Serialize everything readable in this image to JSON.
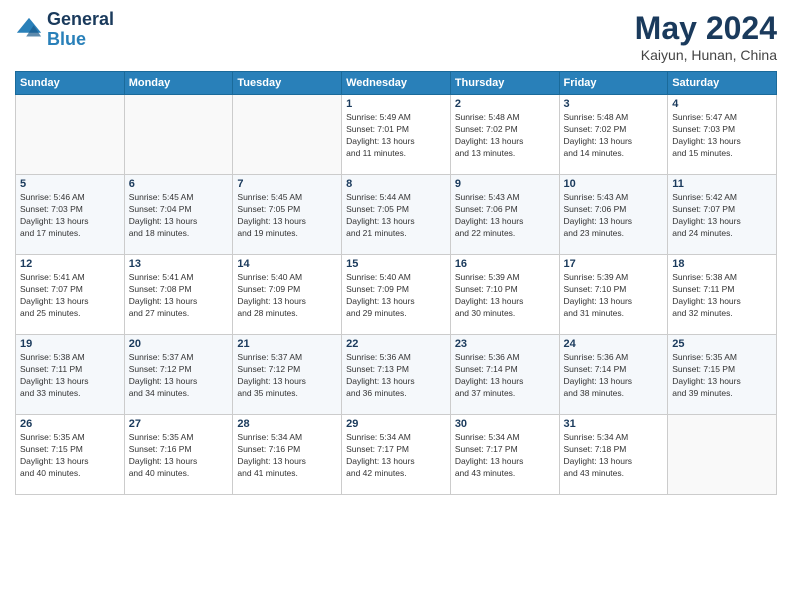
{
  "header": {
    "logo_line1": "General",
    "logo_line2": "Blue",
    "month": "May 2024",
    "location": "Kaiyun, Hunan, China"
  },
  "weekdays": [
    "Sunday",
    "Monday",
    "Tuesday",
    "Wednesday",
    "Thursday",
    "Friday",
    "Saturday"
  ],
  "weeks": [
    [
      {
        "day": "",
        "info": ""
      },
      {
        "day": "",
        "info": ""
      },
      {
        "day": "",
        "info": ""
      },
      {
        "day": "1",
        "info": "Sunrise: 5:49 AM\nSunset: 7:01 PM\nDaylight: 13 hours\nand 11 minutes."
      },
      {
        "day": "2",
        "info": "Sunrise: 5:48 AM\nSunset: 7:02 PM\nDaylight: 13 hours\nand 13 minutes."
      },
      {
        "day": "3",
        "info": "Sunrise: 5:48 AM\nSunset: 7:02 PM\nDaylight: 13 hours\nand 14 minutes."
      },
      {
        "day": "4",
        "info": "Sunrise: 5:47 AM\nSunset: 7:03 PM\nDaylight: 13 hours\nand 15 minutes."
      }
    ],
    [
      {
        "day": "5",
        "info": "Sunrise: 5:46 AM\nSunset: 7:03 PM\nDaylight: 13 hours\nand 17 minutes."
      },
      {
        "day": "6",
        "info": "Sunrise: 5:45 AM\nSunset: 7:04 PM\nDaylight: 13 hours\nand 18 minutes."
      },
      {
        "day": "7",
        "info": "Sunrise: 5:45 AM\nSunset: 7:05 PM\nDaylight: 13 hours\nand 19 minutes."
      },
      {
        "day": "8",
        "info": "Sunrise: 5:44 AM\nSunset: 7:05 PM\nDaylight: 13 hours\nand 21 minutes."
      },
      {
        "day": "9",
        "info": "Sunrise: 5:43 AM\nSunset: 7:06 PM\nDaylight: 13 hours\nand 22 minutes."
      },
      {
        "day": "10",
        "info": "Sunrise: 5:43 AM\nSunset: 7:06 PM\nDaylight: 13 hours\nand 23 minutes."
      },
      {
        "day": "11",
        "info": "Sunrise: 5:42 AM\nSunset: 7:07 PM\nDaylight: 13 hours\nand 24 minutes."
      }
    ],
    [
      {
        "day": "12",
        "info": "Sunrise: 5:41 AM\nSunset: 7:07 PM\nDaylight: 13 hours\nand 25 minutes."
      },
      {
        "day": "13",
        "info": "Sunrise: 5:41 AM\nSunset: 7:08 PM\nDaylight: 13 hours\nand 27 minutes."
      },
      {
        "day": "14",
        "info": "Sunrise: 5:40 AM\nSunset: 7:09 PM\nDaylight: 13 hours\nand 28 minutes."
      },
      {
        "day": "15",
        "info": "Sunrise: 5:40 AM\nSunset: 7:09 PM\nDaylight: 13 hours\nand 29 minutes."
      },
      {
        "day": "16",
        "info": "Sunrise: 5:39 AM\nSunset: 7:10 PM\nDaylight: 13 hours\nand 30 minutes."
      },
      {
        "day": "17",
        "info": "Sunrise: 5:39 AM\nSunset: 7:10 PM\nDaylight: 13 hours\nand 31 minutes."
      },
      {
        "day": "18",
        "info": "Sunrise: 5:38 AM\nSunset: 7:11 PM\nDaylight: 13 hours\nand 32 minutes."
      }
    ],
    [
      {
        "day": "19",
        "info": "Sunrise: 5:38 AM\nSunset: 7:11 PM\nDaylight: 13 hours\nand 33 minutes."
      },
      {
        "day": "20",
        "info": "Sunrise: 5:37 AM\nSunset: 7:12 PM\nDaylight: 13 hours\nand 34 minutes."
      },
      {
        "day": "21",
        "info": "Sunrise: 5:37 AM\nSunset: 7:12 PM\nDaylight: 13 hours\nand 35 minutes."
      },
      {
        "day": "22",
        "info": "Sunrise: 5:36 AM\nSunset: 7:13 PM\nDaylight: 13 hours\nand 36 minutes."
      },
      {
        "day": "23",
        "info": "Sunrise: 5:36 AM\nSunset: 7:14 PM\nDaylight: 13 hours\nand 37 minutes."
      },
      {
        "day": "24",
        "info": "Sunrise: 5:36 AM\nSunset: 7:14 PM\nDaylight: 13 hours\nand 38 minutes."
      },
      {
        "day": "25",
        "info": "Sunrise: 5:35 AM\nSunset: 7:15 PM\nDaylight: 13 hours\nand 39 minutes."
      }
    ],
    [
      {
        "day": "26",
        "info": "Sunrise: 5:35 AM\nSunset: 7:15 PM\nDaylight: 13 hours\nand 40 minutes."
      },
      {
        "day": "27",
        "info": "Sunrise: 5:35 AM\nSunset: 7:16 PM\nDaylight: 13 hours\nand 40 minutes."
      },
      {
        "day": "28",
        "info": "Sunrise: 5:34 AM\nSunset: 7:16 PM\nDaylight: 13 hours\nand 41 minutes."
      },
      {
        "day": "29",
        "info": "Sunrise: 5:34 AM\nSunset: 7:17 PM\nDaylight: 13 hours\nand 42 minutes."
      },
      {
        "day": "30",
        "info": "Sunrise: 5:34 AM\nSunset: 7:17 PM\nDaylight: 13 hours\nand 43 minutes."
      },
      {
        "day": "31",
        "info": "Sunrise: 5:34 AM\nSunset: 7:18 PM\nDaylight: 13 hours\nand 43 minutes."
      },
      {
        "day": "",
        "info": ""
      }
    ]
  ]
}
